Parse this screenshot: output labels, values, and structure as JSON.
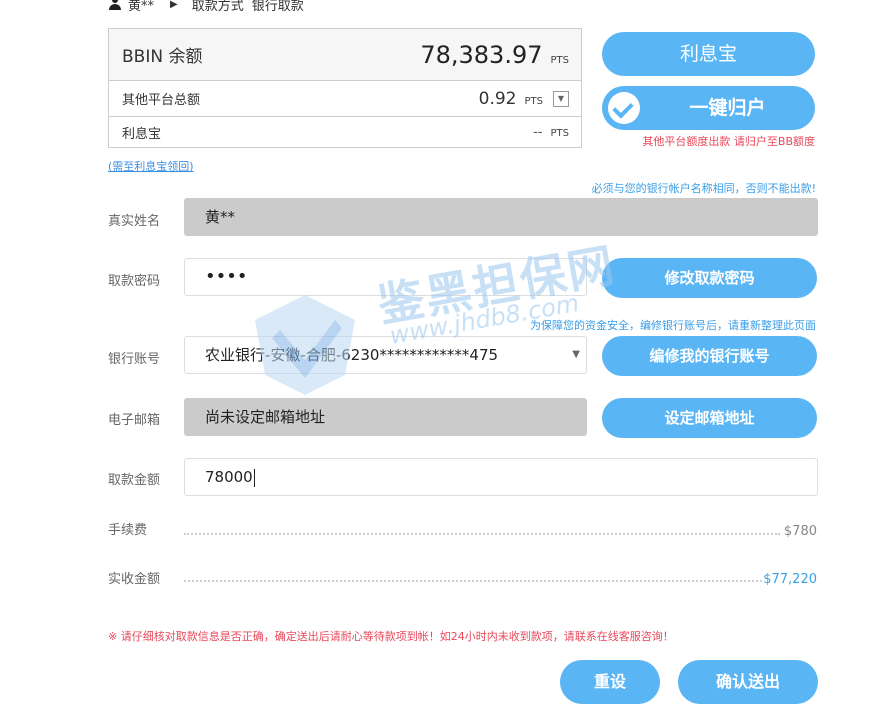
{
  "breadcrumb": {
    "user": "黄**",
    "crumb1": "取款方式",
    "crumb2": "银行取款"
  },
  "balance": {
    "main_label": "BBIN 余额",
    "main_value": "78,383.97",
    "unit": "PTS",
    "other_label": "其他平台总额",
    "other_value": "0.92",
    "lixi_label": "利息宝",
    "lixi_value": "--",
    "collect_link": "(需至利息宝领回)"
  },
  "actions": {
    "lixi_button": "利息宝",
    "yijian_button": "一键归户",
    "yijian_note": "其他平台额度出款 请归户至BB额度"
  },
  "notes": {
    "name_match": "必须与您的银行帐户名称相同，否则不能出款!",
    "edit_notice": "为保障您的资金安全，编修银行账号后，请重新整理此页面"
  },
  "form": {
    "name_label": "真实姓名",
    "name_value": "黄**",
    "password_label": "取款密码",
    "password_value": "••••",
    "password_button": "修改取款密码",
    "bank_label": "银行账号",
    "bank_value": "农业银行-安徽-合肥-6230************475",
    "bank_button": "编修我的银行账号",
    "email_label": "电子邮箱",
    "email_value": "尚未设定邮箱地址",
    "email_button": "设定邮箱地址",
    "amount_label": "取款金额",
    "amount_value": "78000",
    "fee_label": "手续费",
    "fee_value": "$780",
    "actual_label": "实收金额",
    "actual_value": "$77,220"
  },
  "warning": "※ 请仔细核对取款信息是否正确，确定送出后请耐心等待款项到帐！如24小时内未收到款项，请联系在线客服咨询！",
  "buttons": {
    "reset": "重设",
    "submit": "确认送出"
  },
  "watermark": {
    "title": "鉴黑担保网",
    "url": "www.jhdb8.com"
  },
  "colors": {
    "accent": "#5ab5f5",
    "alert": "#e8485a",
    "info": "#3a9ee8"
  }
}
